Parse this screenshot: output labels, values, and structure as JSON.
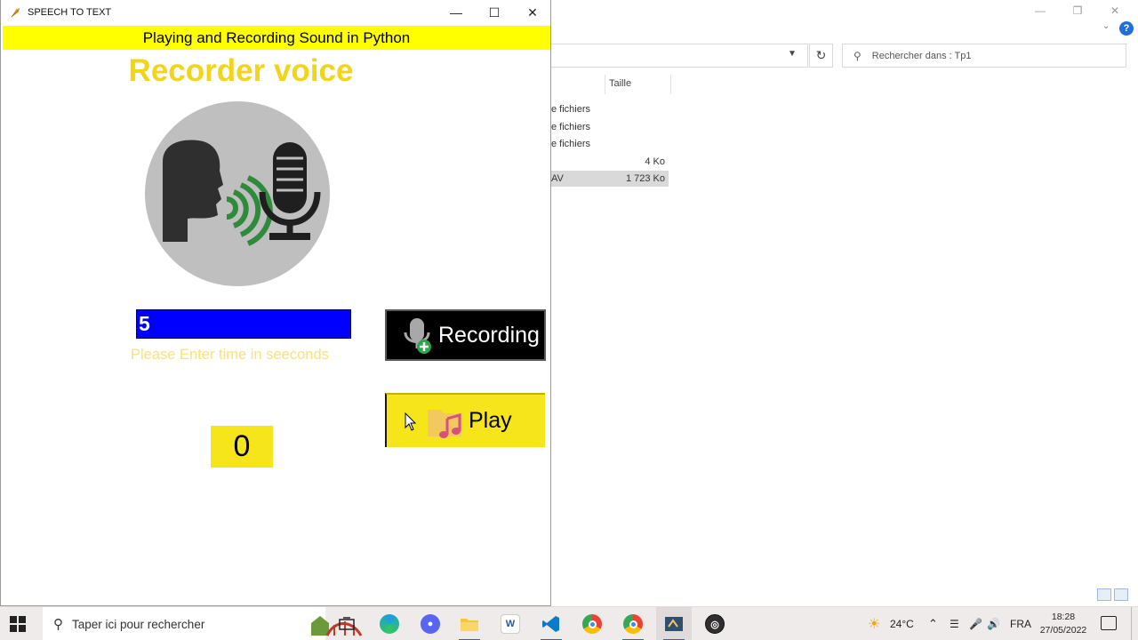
{
  "app": {
    "window_title": "SPEECH TO TEXT",
    "banner_text": "Playing and Recording Sound in Python",
    "heading": "Recorder voice",
    "time_input_value": "5",
    "time_hint": "Please Enter time in seeconds",
    "counter_value": "0",
    "record_button_label": "Recording",
    "play_button_label": "Play",
    "colors": {
      "banner": "#ffff00",
      "heading": "#f2d41a",
      "input_bg": "#0000ff",
      "accent_yellow": "#f7e51b",
      "record_bg": "#000000"
    }
  },
  "explorer": {
    "search_placeholder": "Rechercher dans : Tp1",
    "column_size": "Taille",
    "rows": [
      {
        "type": "e fichiers",
        "size": ""
      },
      {
        "type": "e fichiers",
        "size": ""
      },
      {
        "type": "e fichiers",
        "size": ""
      },
      {
        "type": "",
        "size": "4 Ko"
      },
      {
        "type": "AV",
        "size": "1 723 Ko"
      }
    ]
  },
  "taskbar": {
    "search_placeholder": "Taper ici pour rechercher",
    "temperature": "24°C",
    "language": "FRA",
    "time": "18:28",
    "date": "27/05/2022"
  }
}
